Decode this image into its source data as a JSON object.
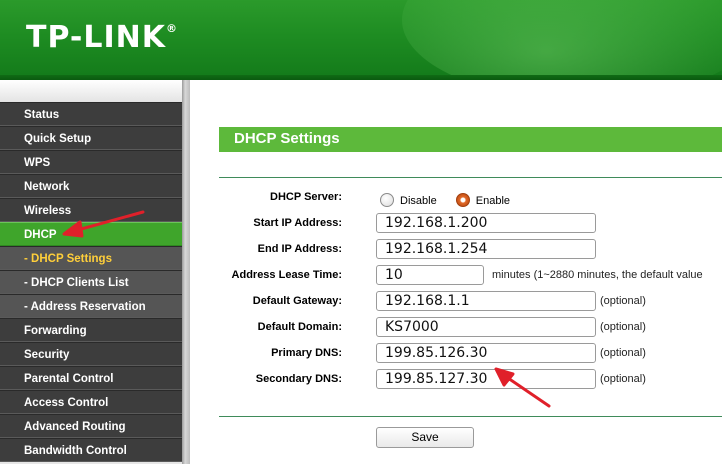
{
  "brand": {
    "logo_text": "TP-LINK",
    "trademark": "®"
  },
  "colors": {
    "header_green": "#1e8c22",
    "accent_green": "#5db93b",
    "sidebar_bg": "#3d3d3d",
    "sub_item_highlight": "#ffcf3a",
    "annotation_red": "#e0202a"
  },
  "sidebar": {
    "items": [
      {
        "label": "Status"
      },
      {
        "label": "Quick Setup"
      },
      {
        "label": "WPS"
      },
      {
        "label": "Network"
      },
      {
        "label": "Wireless"
      },
      {
        "label": "DHCP",
        "active": true
      },
      {
        "label": "- DHCP Settings",
        "sub": true,
        "current": true
      },
      {
        "label": "- DHCP Clients List",
        "sub": true
      },
      {
        "label": "- Address Reservation",
        "sub": true
      },
      {
        "label": "Forwarding"
      },
      {
        "label": "Security"
      },
      {
        "label": "Parental Control"
      },
      {
        "label": "Access Control"
      },
      {
        "label": "Advanced Routing"
      },
      {
        "label": "Bandwidth Control"
      }
    ]
  },
  "main": {
    "title": "DHCP Settings",
    "dhcp_server": {
      "label": "DHCP Server:",
      "options": [
        {
          "label": "Disable",
          "selected": false
        },
        {
          "label": "Enable",
          "selected": true
        }
      ]
    },
    "fields": {
      "start_ip": {
        "label": "Start IP Address:",
        "value": "192.168.1.200"
      },
      "end_ip": {
        "label": "End IP Address:",
        "value": "192.168.1.254"
      },
      "lease_time": {
        "label": "Address Lease Time:",
        "value": "10",
        "hint": "minutes (1~2880 minutes, the default value"
      },
      "gateway": {
        "label": "Default Gateway:",
        "value": "192.168.1.1",
        "hint": "(optional)"
      },
      "domain": {
        "label": "Default Domain:",
        "value": "KS7000",
        "hint": "(optional)"
      },
      "primary_dns": {
        "label": "Primary DNS:",
        "value": "199.85.126.30",
        "hint": "(optional)"
      },
      "secondary_dns": {
        "label": "Secondary DNS:",
        "value": "199.85.127.30",
        "hint": "(optional)"
      }
    },
    "save_label": "Save"
  }
}
